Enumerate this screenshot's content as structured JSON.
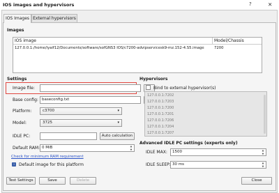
{
  "window": {
    "title": "IOS images and hypervisors",
    "help_glyph": "?",
    "close_glyph": "✕"
  },
  "tabs": [
    {
      "label": "IOS Images"
    },
    {
      "label": "External hypervisors"
    }
  ],
  "images": {
    "section_label": "Images",
    "columns": [
      "IOS image",
      "Model/Chassis"
    ],
    "rows": [
      {
        "path": "127.0.0.1:/home/iyaif12/Documents/software/sofGNS3 IOS/c7200-advipservicesk9-mz.152-4.S5.image",
        "model": "7200"
      }
    ]
  },
  "settings": {
    "section_label": "Settings",
    "image_file_label": "Image file:",
    "image_file_value": "",
    "browse_label": "...",
    "base_config_label": "Base config:",
    "base_config_value": "baseconfig.txt",
    "platform_label": "Platform:",
    "platform_value": "c3700",
    "model_label": "Model:",
    "model_value": "3725",
    "idle_pc_label": "IDLE PC:",
    "idle_pc_value": "",
    "auto_calc_label": "Auto calculation",
    "default_ram_label": "Default RAM:",
    "default_ram_value": "0 MiB",
    "min_ram_link": "Check for minimum RAM requirement",
    "default_image_label": "Default image for this platform"
  },
  "hypervisors": {
    "section_label": "Hypervisors",
    "bind_label": "Bind to external hypervisor(s)",
    "list": [
      "127.0.0.1:7202",
      "127.0.0.1:7203",
      "127.0.0.1:7200",
      "127.0.0.1:7201",
      "127.0.0.1:7206",
      "127.0.0.1:7204",
      "127.0.0.1:7207"
    ]
  },
  "idle": {
    "section_label": "Advanced IDLE PC settings (experts only)",
    "max_label": "IDLE MAX:",
    "max_value": "1500",
    "sleep_label": "IDLE SLEEP:",
    "sleep_value": "30 ms"
  },
  "buttons": {
    "test": "Test Settings",
    "save": "Save",
    "delete": "Delete",
    "close": "Close"
  },
  "icons": {
    "combo_arrow": "▾",
    "spin_up": "▲",
    "spin_down": "▼",
    "info": "i"
  }
}
